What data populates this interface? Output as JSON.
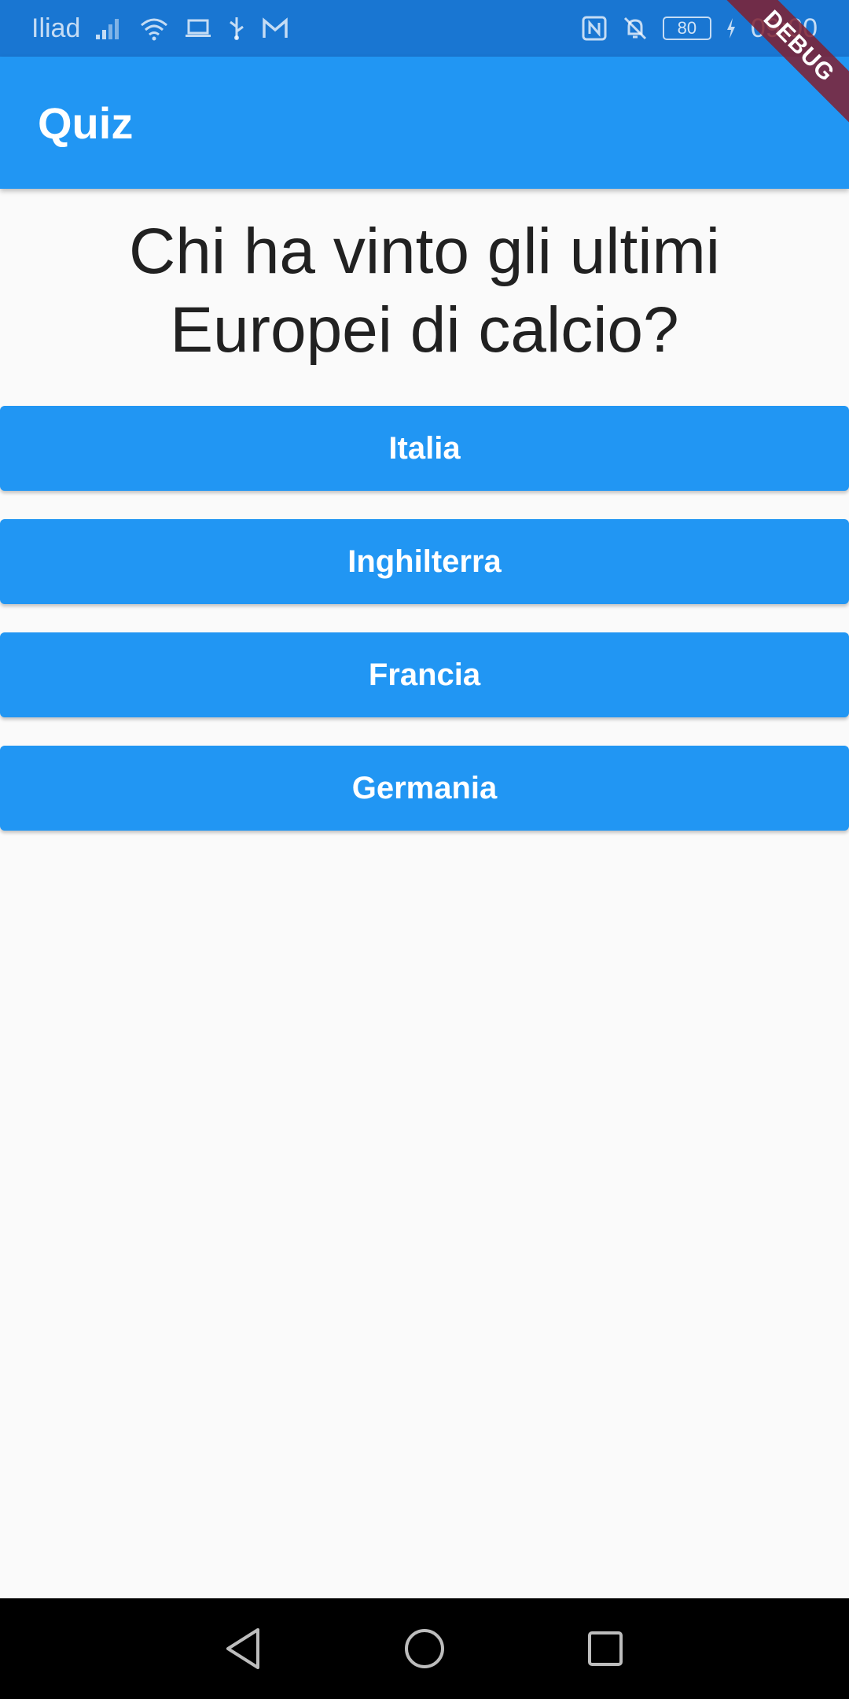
{
  "status_bar": {
    "carrier": "Iliad",
    "battery": "80",
    "time": "09:00"
  },
  "debug_banner": "DEBUG",
  "app_bar": {
    "title": "Quiz"
  },
  "question": "Chi ha vinto gli ultimi Europei di calcio?",
  "answers": [
    {
      "label": "Italia"
    },
    {
      "label": "Inghilterra"
    },
    {
      "label": "Francia"
    },
    {
      "label": "Germania"
    }
  ],
  "nav_bar": {
    "icons": [
      "back-icon",
      "home-icon",
      "recents-icon"
    ]
  },
  "colors": {
    "primary": "#2196f3",
    "status_bar": "#1976d2",
    "background": "#fafafa",
    "text": "#212121"
  }
}
